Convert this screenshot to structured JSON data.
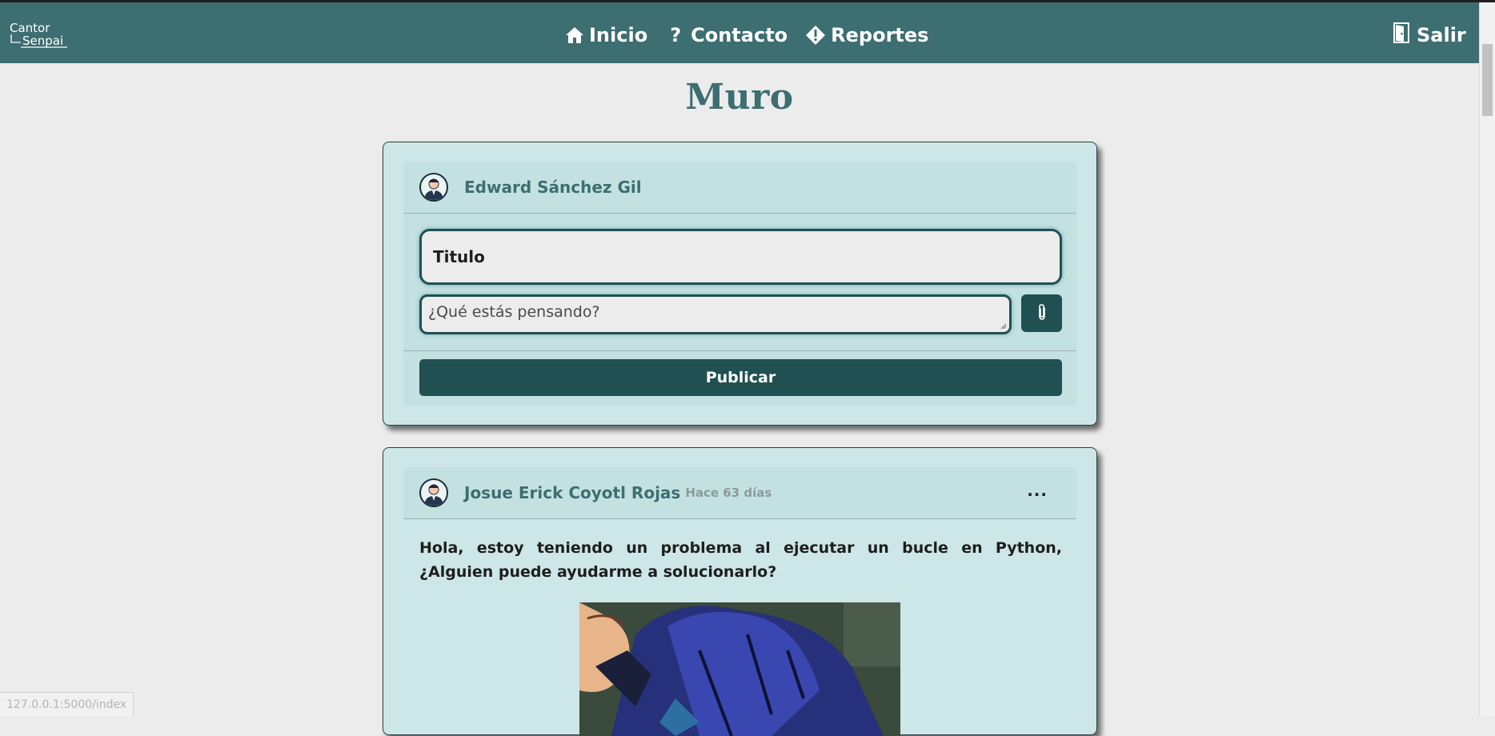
{
  "navbar": {
    "logo_line1": "Cantor",
    "logo_line2": "Senpai",
    "links": [
      {
        "label": "Inicio",
        "icon": "home-icon"
      },
      {
        "label": "Contacto",
        "icon": "question-icon"
      },
      {
        "label": "Reportes",
        "icon": "alert-diamond-icon"
      }
    ],
    "exit_label": "Salir",
    "exit_icon": "door-exit-icon",
    "background_color": "#3d6e71"
  },
  "page": {
    "title": "Muro"
  },
  "composer": {
    "user_name": "Edward Sánchez Gil",
    "title_value": "Titulo",
    "body_placeholder": "¿Qué estás pensando?",
    "attach_icon": "paperclip-icon",
    "publish_label": "Publicar"
  },
  "posts": [
    {
      "author": "Josue Erick Coyotl Rojas",
      "time_ago": "Hace 63 días",
      "menu_label": "···",
      "text": "Hola, estoy teniendo un problema al ejecutar un bucle en Python, ¿Alguien puede ayudarme a solucionarlo?"
    }
  ],
  "status_bar": {
    "url": "127.0.0.1:5000/index"
  },
  "colors": {
    "accent": "#3d6e71",
    "dark_teal": "#215052",
    "card_bg": "#cde6e7",
    "page_bg": "#ececec"
  }
}
